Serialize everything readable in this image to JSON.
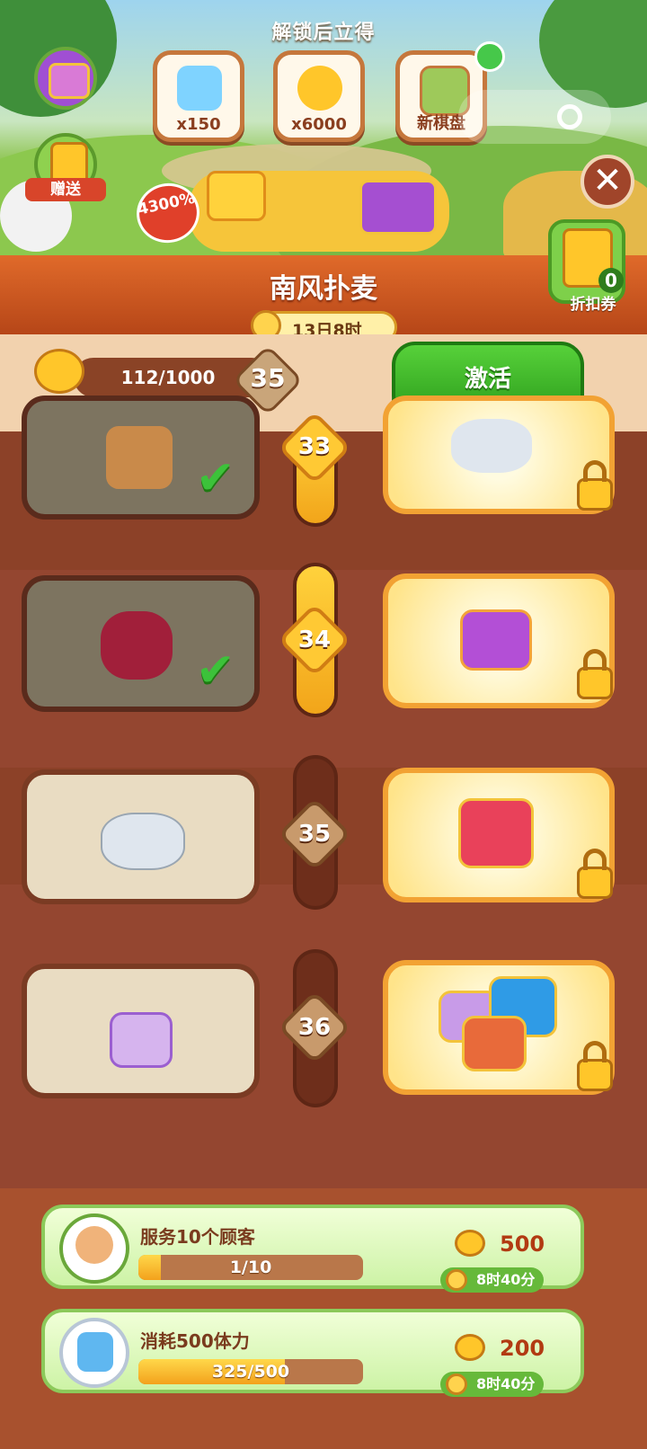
{
  "banner": {
    "unlock_title": "解锁后立得",
    "rewards": [
      {
        "label": "x150",
        "icon": "energy-bolt-icon"
      },
      {
        "label": "x6000",
        "icon": "bee-icon"
      },
      {
        "label": "新棋盘",
        "icon": "new-board-icon"
      }
    ],
    "gift_label": "赠送",
    "bonus_badge": "4300%",
    "coupon_label": "折扣券",
    "coupon_count": "0"
  },
  "event": {
    "title": "南风扑麦",
    "timer": "13日8时"
  },
  "progress": {
    "value_text": "112/1000",
    "fraction": 0.112,
    "level": "35",
    "activate_label": "激活"
  },
  "tiers": [
    {
      "level": "33",
      "free_item": "mystery-box-icon",
      "paid_item": "shell-bowl-icon",
      "claimed": true
    },
    {
      "level": "34",
      "free_item": "ruby-gem-icon",
      "paid_item": "purple-chest-icon",
      "claimed": true
    },
    {
      "level": "35",
      "free_item": "shell-bowl-icon",
      "paid_item": "mystery-chest-icon",
      "claimed": false
    },
    {
      "level": "36",
      "free_item": "purple-star-chest-icon",
      "paid_item": "chest-bundle-icon",
      "claimed": false
    }
  ],
  "tasks": [
    {
      "title": "服务10个顾客",
      "progress_text": "1/10",
      "fraction": 0.1,
      "reward": "500",
      "time": "8时40分"
    },
    {
      "title": "消耗500体力",
      "progress_text": "325/500",
      "fraction": 0.65,
      "reward": "200",
      "time": "8时40分"
    }
  ],
  "colors": {
    "activate": "#2d9e1c",
    "ribbon": "#c9501c",
    "paid_card": "#f2a233"
  }
}
